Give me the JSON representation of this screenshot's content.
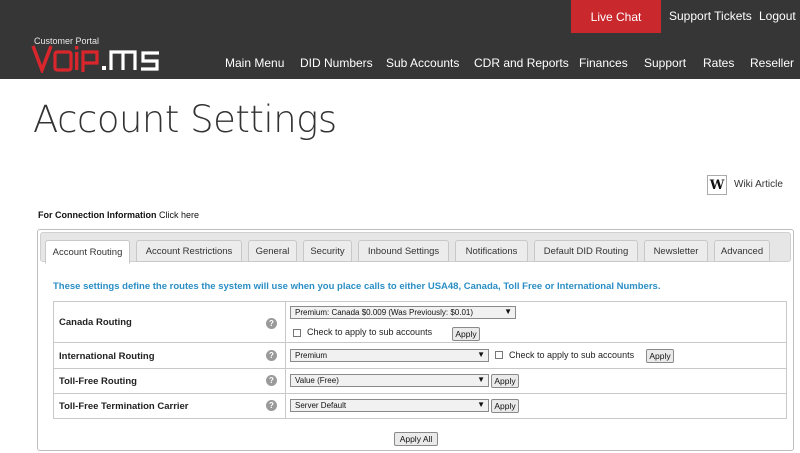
{
  "header": {
    "live_chat": "Live Chat",
    "support_tickets": "Support Tickets",
    "logout": "Logout",
    "portal_label": "Customer Portal",
    "logo_text": "VOiP.MS",
    "accent_color": "#c9282d",
    "bg_color": "#363636",
    "nav": [
      "Main Menu",
      "DID Numbers",
      "Sub Accounts",
      "CDR and Reports",
      "Finances",
      "Support",
      "Rates",
      "Reseller"
    ]
  },
  "page": {
    "title": "Account Settings",
    "wiki_icon": "W",
    "wiki_label": "Wiki Article",
    "conn_info_bold": "For Connection Information",
    "conn_info_link": "Click here"
  },
  "tabs": [
    "Account Routing",
    "Account Restrictions",
    "General",
    "Security",
    "Inbound Settings",
    "Notifications",
    "Default DID Routing",
    "Newsletter",
    "Advanced"
  ],
  "active_tab": "Account Routing",
  "routing": {
    "intro": "These settings define the routes the system will use when you place calls to either USA48, Canada, Toll Free or International Numbers.",
    "help_icon": "?",
    "apply_label": "Apply",
    "sub_accounts_label": "Check to apply to sub accounts",
    "rows": [
      {
        "label": "Canada Routing",
        "value": "Premium: Canada $0.009 (Was Previously: $0.01)"
      },
      {
        "label": "International Routing",
        "value": "Premium"
      },
      {
        "label": "Toll-Free Routing",
        "value": "Value (Free)"
      },
      {
        "label": "Toll-Free Termination Carrier",
        "value": "Server Default"
      }
    ],
    "apply_all_label": "Apply All"
  }
}
